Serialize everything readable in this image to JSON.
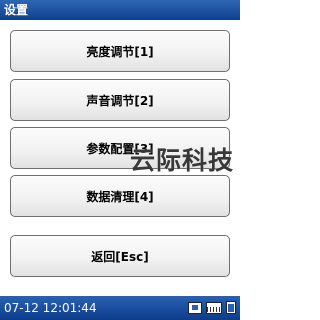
{
  "window": {
    "title": "设置"
  },
  "menu": {
    "items": [
      {
        "label": "亮度调节[1]"
      },
      {
        "label": "声音调节[2]"
      },
      {
        "label": "参数配置[3]"
      },
      {
        "label": "数据清理[4]"
      },
      {
        "label": "返回[Esc]"
      }
    ]
  },
  "watermark": {
    "text": "云际科技"
  },
  "status": {
    "datetime": "07-12 12:01:44",
    "icons": [
      "network-icon",
      "keyboard-icon",
      "battery-icon"
    ]
  },
  "colors": {
    "titlebar": "#1f57a8",
    "statusbar": "#1a4f9e",
    "button_border": "#6f6f6f"
  }
}
